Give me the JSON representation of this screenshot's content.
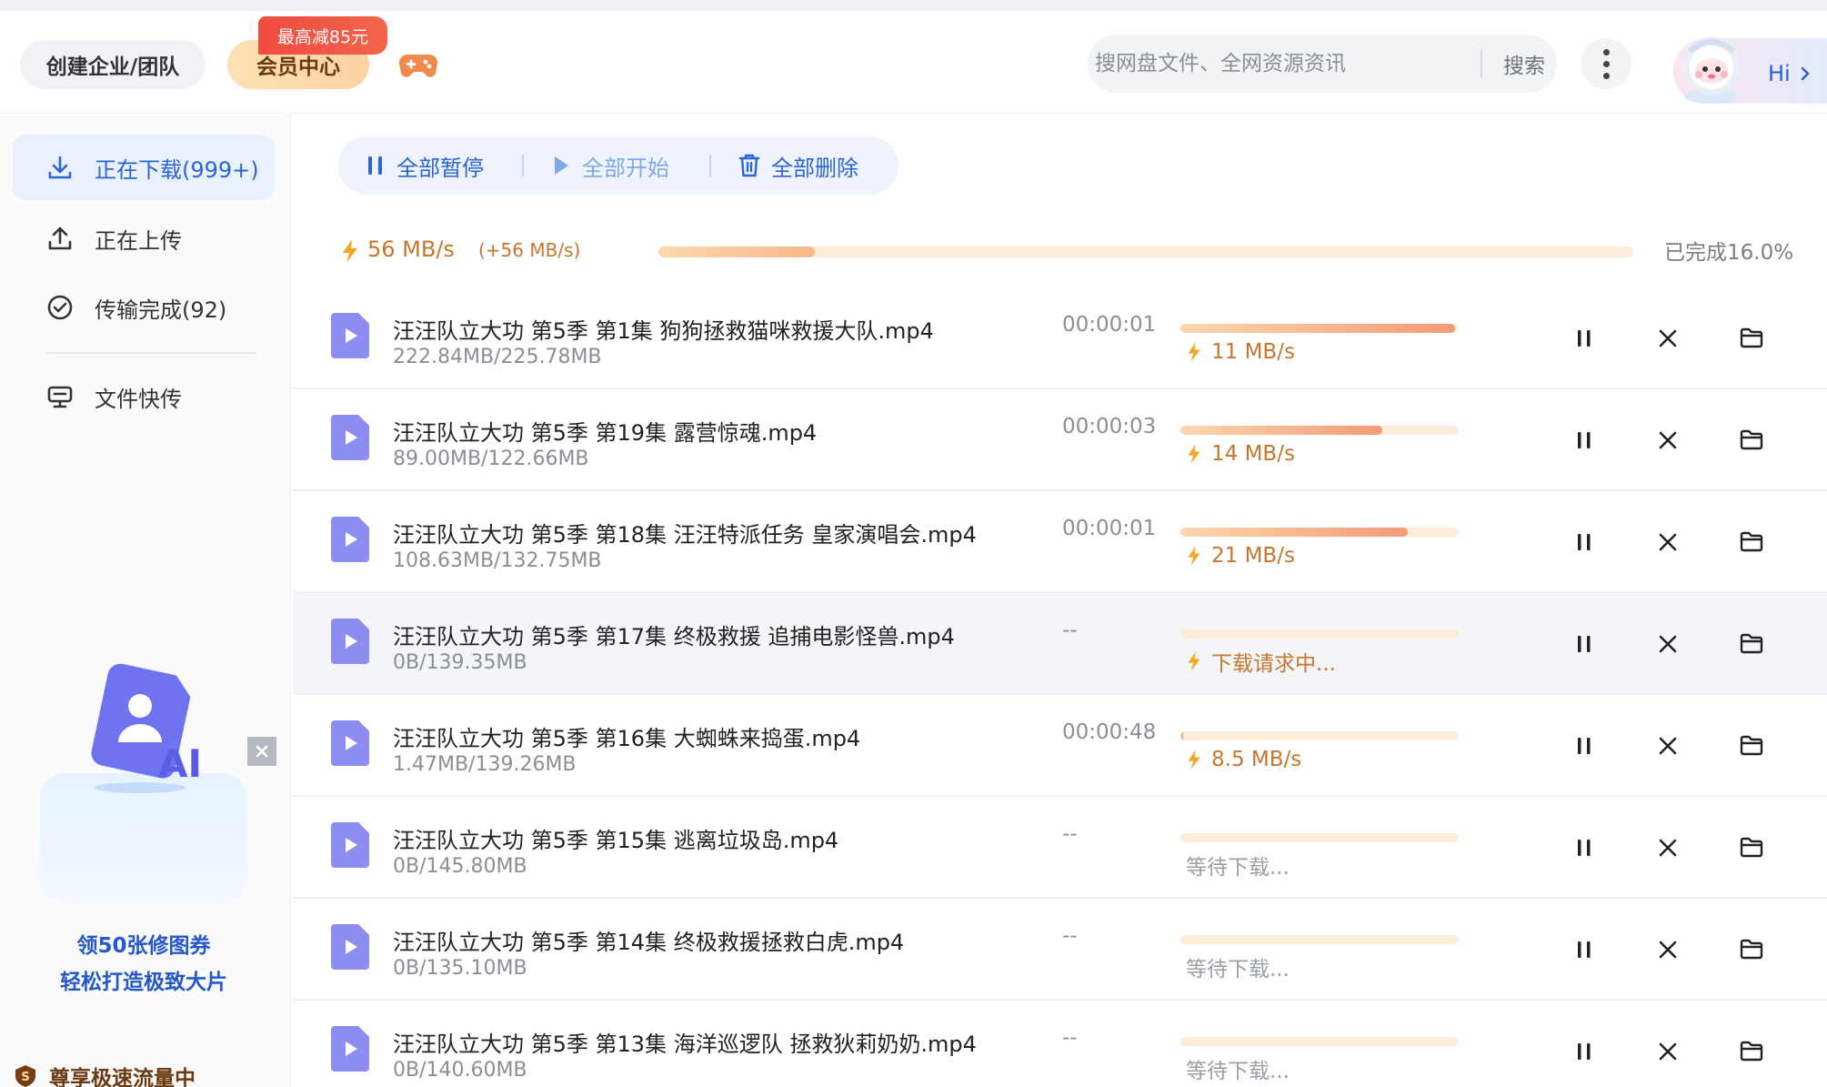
{
  "header": {
    "team_button": "创建企业/团队",
    "vip_button": "会员中心",
    "vip_tag": "最高减85元",
    "search_placeholder": "搜网盘文件、全网资源资讯",
    "search_button": "搜索",
    "greeting": "Hi"
  },
  "sidebar": {
    "items": [
      {
        "label": "正在下载(999+)",
        "icon": "download-icon",
        "active": true
      },
      {
        "label": "正在上传",
        "icon": "upload-icon",
        "active": false
      },
      {
        "label": "传输完成(92)",
        "icon": "check-circle-icon",
        "active": false
      },
      {
        "label": "文件快传",
        "icon": "monitor-icon",
        "active": false
      }
    ],
    "ad": {
      "line1": "领50张修图券",
      "line2": "轻松打造极致大片"
    },
    "flow_text": "尊享极速流量中"
  },
  "toolbar": {
    "pause_all": "全部暂停",
    "start_all": "全部开始",
    "delete_all": "全部删除"
  },
  "summary": {
    "speed": "56 MB/s",
    "boost": "(+56 MB/s)",
    "progress": 0.16,
    "done_text": "已完成16.0%"
  },
  "downloads": [
    {
      "name": "汪汪队立大功 第5季 第1集 狗狗拯救猫咪救援大队.mp4",
      "size": "222.84MB/225.78MB",
      "time": "00:00:01",
      "progress": 0.987,
      "status": "11 MB/s",
      "state": "downloading"
    },
    {
      "name": "汪汪队立大功 第5季 第19集 露营惊魂.mp4",
      "size": "89.00MB/122.66MB",
      "time": "00:00:03",
      "progress": 0.726,
      "status": "14 MB/s",
      "state": "downloading"
    },
    {
      "name": "汪汪队立大功 第5季 第18集 汪汪特派任务 皇家演唱会.mp4",
      "size": "108.63MB/132.75MB",
      "time": "00:00:01",
      "progress": 0.818,
      "status": "21 MB/s",
      "state": "downloading"
    },
    {
      "name": "汪汪队立大功 第5季 第17集 终极救援 追捕电影怪兽.mp4",
      "size": "0B/139.35MB",
      "time": "--",
      "progress": 0,
      "status": "下载请求中...",
      "state": "requesting"
    },
    {
      "name": "汪汪队立大功 第5季 第16集 大蜘蛛来捣蛋.mp4",
      "size": "1.47MB/139.26MB",
      "time": "00:00:48",
      "progress": 0.011,
      "status": "8.5 MB/s",
      "state": "downloading"
    },
    {
      "name": "汪汪队立大功 第5季 第15集 逃离垃圾岛.mp4",
      "size": "0B/145.80MB",
      "time": "--",
      "progress": 0,
      "status": "等待下载...",
      "state": "waiting"
    },
    {
      "name": "汪汪队立大功 第5季 第14集 终极救援拯救白虎.mp4",
      "size": "0B/135.10MB",
      "time": "--",
      "progress": 0,
      "status": "等待下载...",
      "state": "waiting"
    },
    {
      "name": "汪汪队立大功 第5季 第13集 海洋巡逻队 拯救狄莉奶奶.mp4",
      "size": "0B/140.60MB",
      "time": "--",
      "progress": 0,
      "status": "等待下载...",
      "state": "waiting"
    }
  ],
  "colors": {
    "accent": "#2a64d8",
    "speed": "#c8752d",
    "progress_track": "#fcecd9",
    "progress_fill": "#f49a76",
    "file_icon": "#8d8cf0"
  }
}
